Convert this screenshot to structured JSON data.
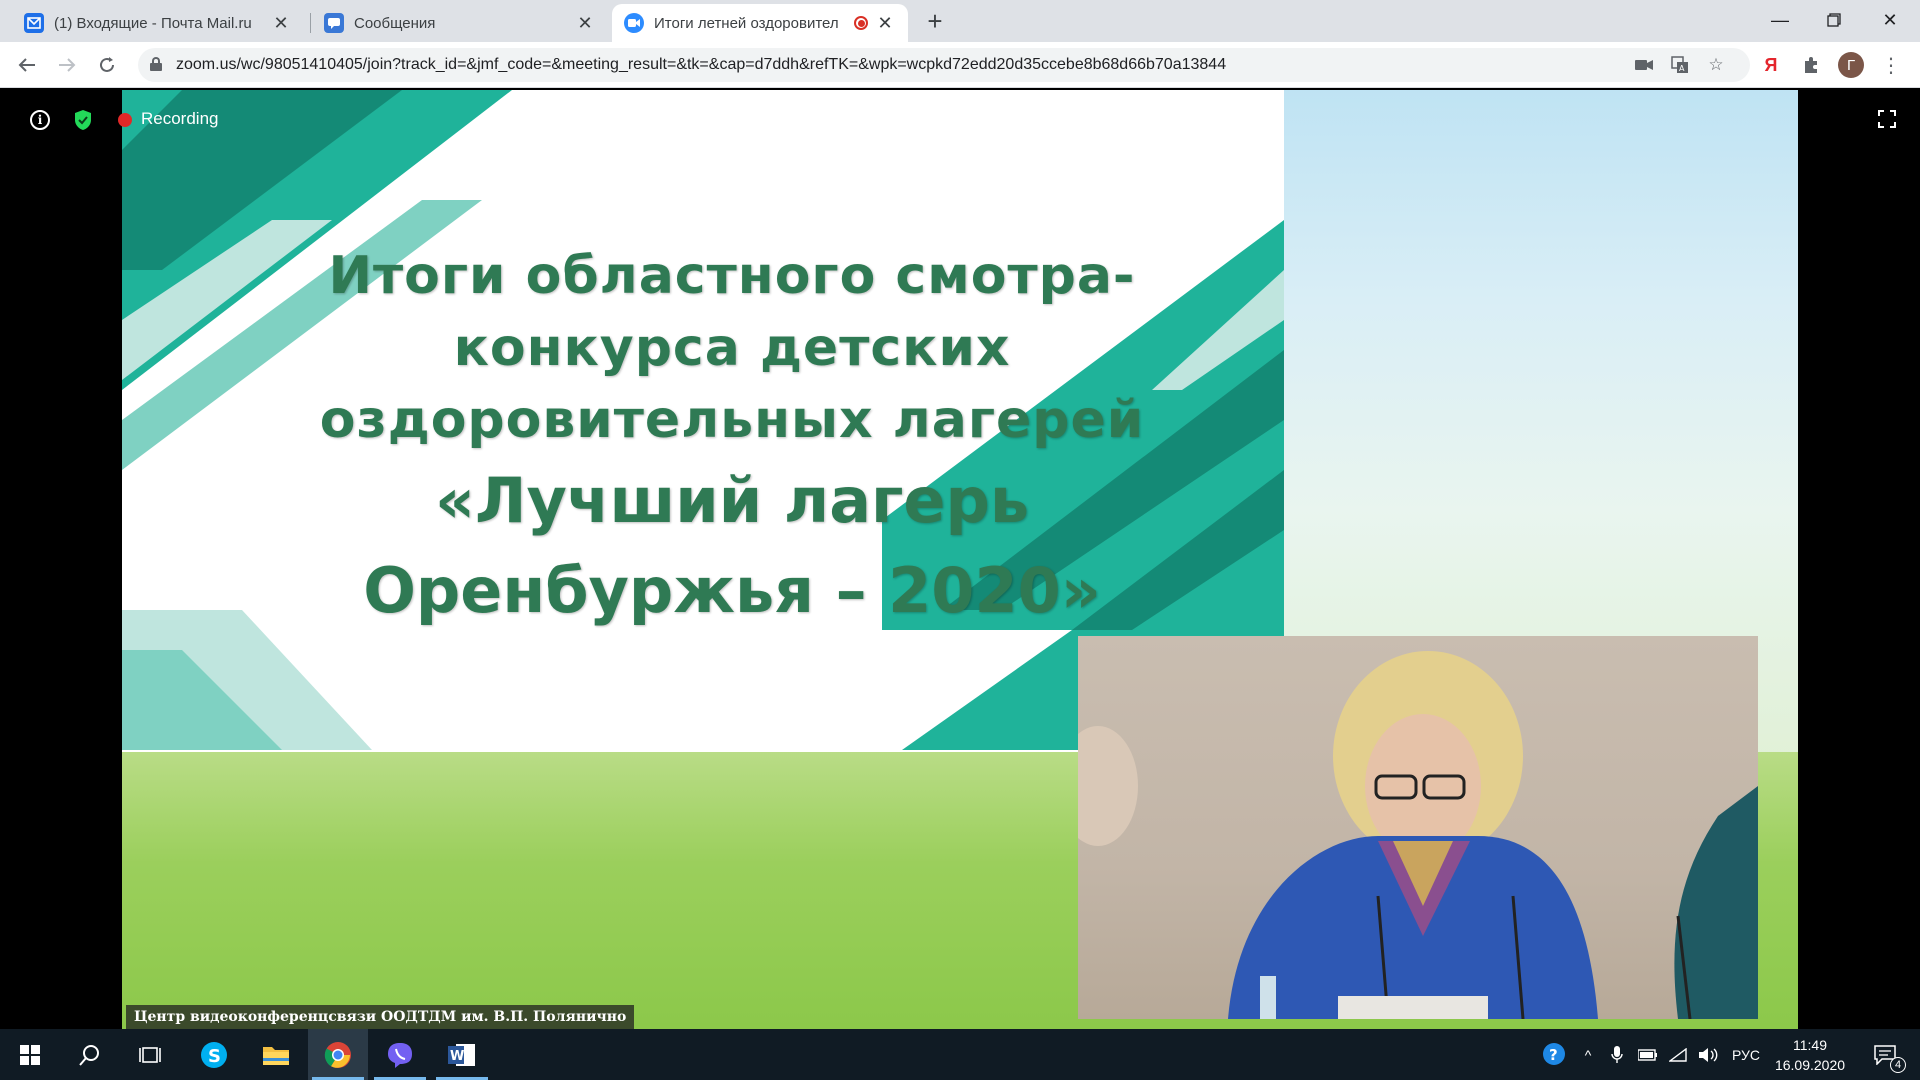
{
  "browser": {
    "tabs": [
      {
        "title": "(1) Входящие - Почта Mail.ru",
        "icon": "mail-icon",
        "color": "#1e6fe8"
      },
      {
        "title": "Сообщения",
        "icon": "chat-icon",
        "color": "#3a78d6"
      },
      {
        "title": "Итоги летней оздоровител",
        "icon": "zoom-icon",
        "color": "#2d8cff",
        "recording": true
      }
    ],
    "url": "zoom.us/wc/98051410405/join?track_id=&jmf_code=&meeting_result=&tk=&cap=d7ddh&refTK=&wpk=wcpkd72edd20d35ccebe8b68d66b70a13844",
    "profile_initial": "Г",
    "yandex_label": "Я"
  },
  "meeting": {
    "recording_label": "Recording",
    "slide": {
      "line1": "Итоги областного смотра-",
      "line2": "конкурса детских",
      "line3": "оздоровительных лагерей",
      "line4": "«Лучший лагерь",
      "line5": "Оренбуржья – 2020»"
    },
    "caption": "Центр видеоконференцсвязи ООДТДМ им. В.П. Полянично",
    "colors": {
      "title": "#2f7a54",
      "teal": "#21b39a",
      "dark_teal": "#148a76"
    }
  },
  "taskbar": {
    "language": "РУС",
    "time": "11:49",
    "date": "16.09.2020",
    "notifications": "4",
    "apps": [
      "windows-start-icon",
      "search-icon",
      "task-view-icon",
      "skype-icon",
      "file-explorer-icon",
      "chrome-icon",
      "viber-icon",
      "word-icon"
    ]
  }
}
